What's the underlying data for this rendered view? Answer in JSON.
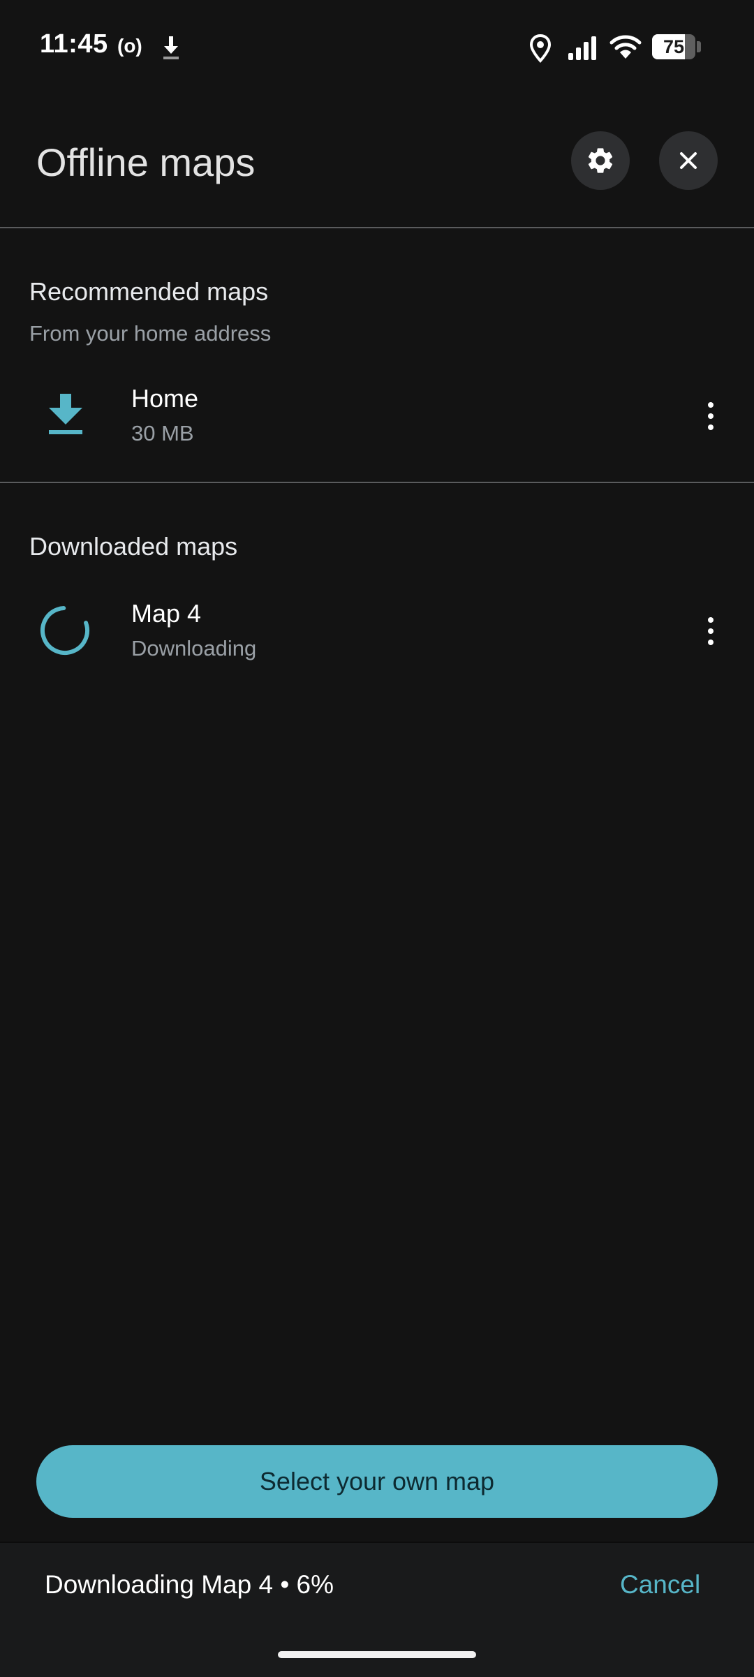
{
  "status_bar": {
    "time": "11:45",
    "hotspot_glyph": "(o)",
    "battery_percent": "75",
    "battery_level": 0.75,
    "icons": [
      "hotspot-icon",
      "download-icon",
      "location-icon",
      "signal-icon",
      "wifi-icon",
      "battery-icon"
    ]
  },
  "header": {
    "title": "Offline maps",
    "settings_icon": "gear-icon",
    "close_icon": "close-icon"
  },
  "recommended": {
    "title": "Recommended maps",
    "subtitle": "From your home address",
    "items": [
      {
        "name": "Home",
        "detail": "30 MB",
        "icon": "download-icon"
      }
    ]
  },
  "downloaded": {
    "title": "Downloaded maps",
    "items": [
      {
        "name": "Map 4",
        "detail": "Downloading",
        "icon": "spinner-icon"
      }
    ]
  },
  "primary_action": {
    "label": "Select your own map"
  },
  "download_progress": {
    "text": "Downloading Map 4 • 6%",
    "cancel_label": "Cancel",
    "percent": 6
  },
  "colors": {
    "background": "#131313",
    "accent": "#57b6c8",
    "text_primary": "#ffffff",
    "text_secondary": "#9aa0a6",
    "divider": "#5a5b5d"
  }
}
